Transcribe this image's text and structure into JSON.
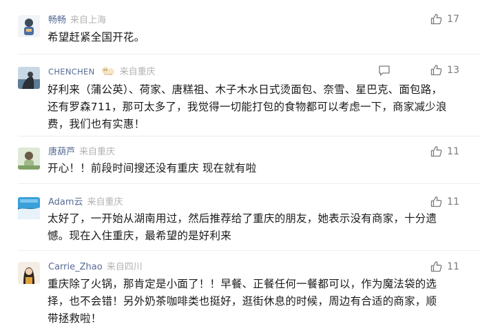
{
  "comments": [
    {
      "user": "畅畅",
      "location": "来自上海",
      "likes": "17",
      "text": "希望赶紧全国开花。"
    },
    {
      "user": "CHENCHEN",
      "location": "来自重庆",
      "likes": "13",
      "text": "好利来（蒲公英）、荷家、唐糕祖、木子木水日式烫面包、奈雪、星巴克、面包路，还有罗森711，那可太多了，我觉得一切能打包的食物都可以考虑一下，商家减少浪费，我们也有实惠！"
    },
    {
      "user": "唐葫芦",
      "location": "来自重庆",
      "likes": "11",
      "text": "开心！！前段时间搜还没有重庆 现在就有啦"
    },
    {
      "user": "Adam云",
      "location": "来自重庆",
      "likes": "11",
      "text": "太好了，一开始从湖南用过，然后推荐给了重庆的朋友，她表示没有商家，十分遗憾。现在入住重庆，最希望的是好利来"
    },
    {
      "user": "Carrie_Zhao",
      "location": "来自四川",
      "likes": "11",
      "text": "重庆除了火锅，那肯定是小面了！！早餐、正餐任何一餐都可以，作为魔法袋的选择，也不会错！另外奶茶咖啡类也挺好，逛街休息的时候，周边有合适的商家，顺带拯救啦！"
    }
  ],
  "colors": {
    "username": "#576b95",
    "location": "#b2b2b2",
    "icon": "#7a7a7a",
    "divider": "#ededed"
  },
  "icons": {
    "like": "thumbs-up-icon",
    "reply": "comment-bubble-icon",
    "badge": "sticker-badge-icon"
  }
}
